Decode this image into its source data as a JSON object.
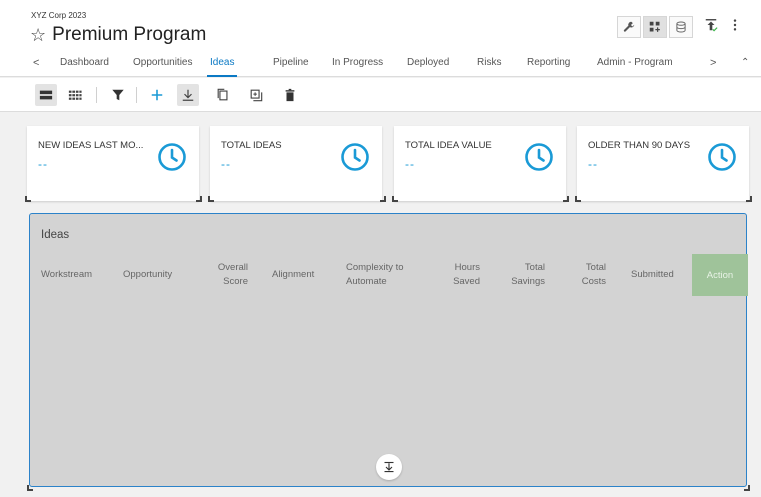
{
  "header": {
    "org": "XYZ Corp 2023",
    "star_glyph": "☆",
    "title": "Premium Program",
    "tools": [
      "wrench-icon",
      "grid-add-icon",
      "database-icon"
    ],
    "right_icons": [
      "publish-icon",
      "more-vertical-icon"
    ]
  },
  "tabs": {
    "prev_glyph": "<",
    "next_glyph": ">",
    "scroll_glyph": "⌃",
    "items": [
      {
        "label": "Dashboard"
      },
      {
        "label": "Opportunities"
      },
      {
        "label": "Ideas"
      },
      {
        "label": "Pipeline"
      },
      {
        "label": "In Progress"
      },
      {
        "label": "Deployed"
      },
      {
        "label": "Risks"
      },
      {
        "label": "Reporting"
      },
      {
        "label": "Admin - Program"
      }
    ],
    "active": "Ideas"
  },
  "toolbar": {
    "icons": [
      "card-view-icon",
      "grid-view-icon",
      "filter-icon",
      "add-icon",
      "download-icon",
      "copy-icon",
      "duplicate-icon",
      "delete-icon"
    ]
  },
  "cards": [
    {
      "label": "NEW IDEAS LAST MO...",
      "value": "--"
    },
    {
      "label": "TOTAL IDEAS",
      "value": "--"
    },
    {
      "label": "TOTAL IDEA VALUE",
      "value": "--"
    },
    {
      "label": "OLDER THAN 90 DAYS",
      "value": "--"
    }
  ],
  "colors": {
    "accent": "#0b79c4",
    "card_value": "#1a9ad6",
    "action_bg": "#9fc39a",
    "panel_bg": "#d3d3d3"
  },
  "ideas": {
    "title": "Ideas",
    "columns": {
      "workstream": "Workstream",
      "opportunity": "Opportunity",
      "overall_1": "Overall",
      "overall_2": "Score",
      "alignment": "Alignment",
      "complexity_1": "Complexity to",
      "complexity_2": "Automate",
      "hours_1": "Hours",
      "hours_2": "Saved",
      "savings_1": "Total",
      "savings_2": "Savings",
      "costs_1": "Total",
      "costs_2": "Costs",
      "submitted": "Submitted",
      "action": "Action"
    }
  }
}
